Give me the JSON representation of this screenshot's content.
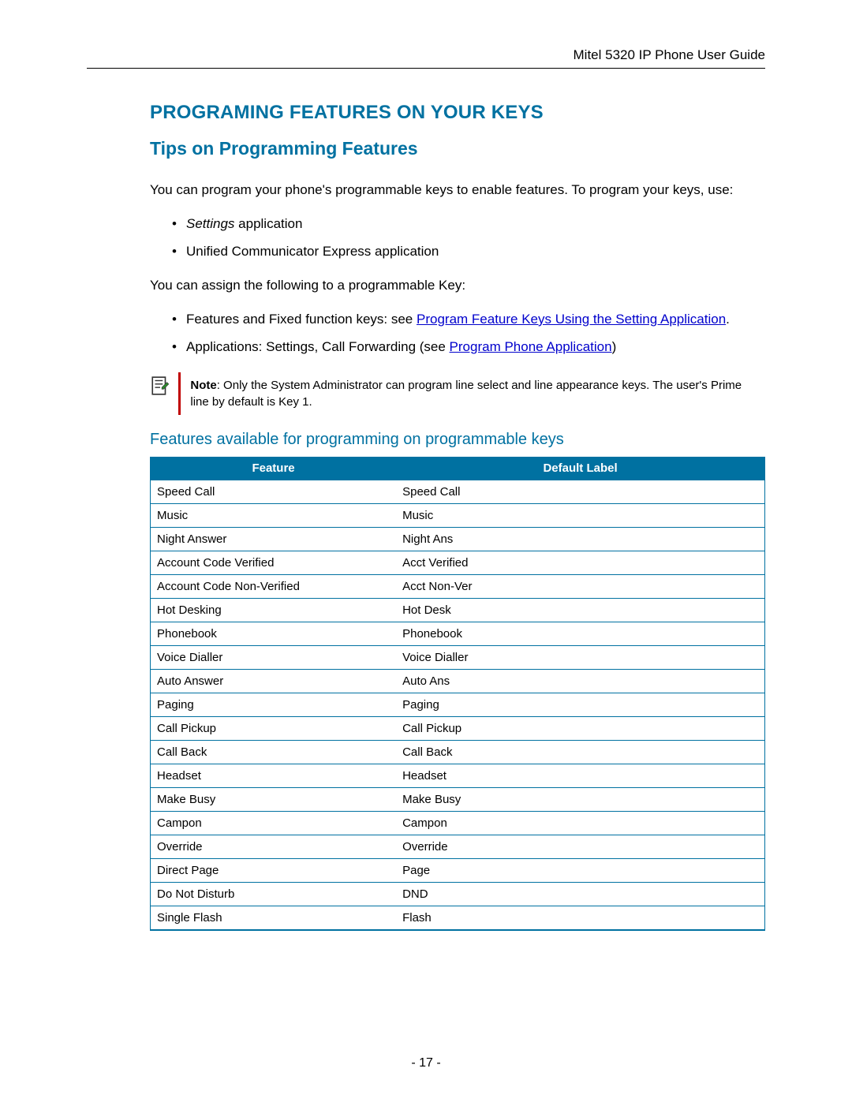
{
  "header": {
    "doc_title": "Mitel 5320 IP Phone User Guide"
  },
  "headings": {
    "h1": "PROGRAMING FEATURES ON YOUR KEYS",
    "h2": "Tips on Programming Features",
    "table_title": "Features available for programming on programmable keys"
  },
  "paragraphs": {
    "intro": "You can program your phone's programmable keys to enable features. To program your keys, use:",
    "assign": "You can assign the following to a programmable Key:"
  },
  "bullets1": {
    "item0_em": "Settings",
    "item0_rest": " application",
    "item1": "Unified Communicator Express application"
  },
  "bullets2": {
    "item0_pre": "Features and Fixed function keys: see ",
    "item0_link": "Program Feature Keys Using the Setting Application",
    "item0_post": ".",
    "item1_pre": "Applications: Settings, Call Forwarding (see ",
    "item1_link": "Program Phone Application",
    "item1_post": ")"
  },
  "note": {
    "label": "Note",
    "text": ": Only the System Administrator can program line select and line appearance keys. The user's Prime line by default is Key 1."
  },
  "table": {
    "headers": {
      "col0": "Feature",
      "col1": "Default Label"
    },
    "rows": [
      {
        "feature": "Speed Call",
        "label": "Speed Call"
      },
      {
        "feature": "Music",
        "label": "Music"
      },
      {
        "feature": "Night Answer",
        "label": "Night Ans"
      },
      {
        "feature": "Account Code Verified",
        "label": "Acct Verified"
      },
      {
        "feature": "Account Code Non-Verified",
        "label": "Acct Non-Ver"
      },
      {
        "feature": "Hot Desking",
        "label": "Hot Desk"
      },
      {
        "feature": "Phonebook",
        "label": "Phonebook"
      },
      {
        "feature": "Voice Dialler",
        "label": "Voice Dialler"
      },
      {
        "feature": "Auto Answer",
        "label": "Auto Ans"
      },
      {
        "feature": "Paging",
        "label": "Paging"
      },
      {
        "feature": "Call Pickup",
        "label": "Call Pickup"
      },
      {
        "feature": "Call Back",
        "label": "Call Back"
      },
      {
        "feature": "Headset",
        "label": "Headset"
      },
      {
        "feature": "Make Busy",
        "label": "Make Busy"
      },
      {
        "feature": "Campon",
        "label": "Campon"
      },
      {
        "feature": "Override",
        "label": "Override"
      },
      {
        "feature": "Direct Page",
        "label": "Page"
      },
      {
        "feature": "Do Not Disturb",
        "label": "DND"
      },
      {
        "feature": "Single Flash",
        "label": "Flash"
      }
    ]
  },
  "page_number": "- 17 -"
}
